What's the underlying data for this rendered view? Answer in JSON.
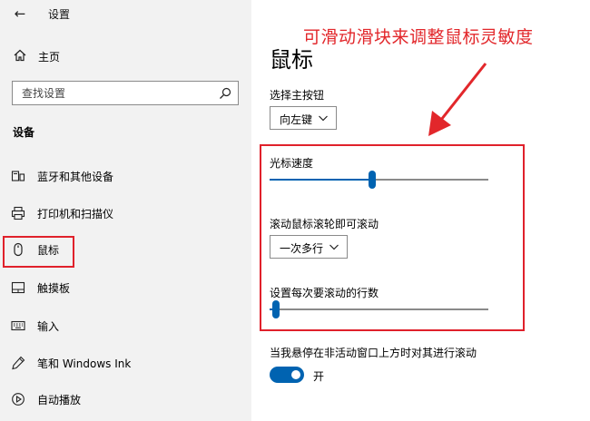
{
  "window": {
    "title": "设置",
    "back_glyph": "←"
  },
  "sidebar": {
    "home_label": "主页",
    "search_placeholder": "查找设置",
    "section_title": "设备",
    "items": [
      {
        "label": "蓝牙和其他设备",
        "icon": "bluetooth-icon"
      },
      {
        "label": "打印机和扫描仪",
        "icon": "printer-icon"
      },
      {
        "label": "鼠标",
        "icon": "mouse-icon",
        "selected": true
      },
      {
        "label": "触摸板",
        "icon": "touchpad-icon"
      },
      {
        "label": "输入",
        "icon": "keyboard-icon"
      },
      {
        "label": "笔和 Windows Ink",
        "icon": "pen-icon"
      },
      {
        "label": "自动播放",
        "icon": "autoplay-icon"
      }
    ]
  },
  "annotation": {
    "text": "可滑动滑块来调整鼠标灵敏度",
    "color": "#e2272b"
  },
  "main": {
    "title": "鼠标",
    "primary_button": {
      "label": "选择主按钮",
      "value": "向左键"
    },
    "cursor_speed": {
      "label": "光标速度",
      "value_fraction": 0.47
    },
    "scroll_setting": {
      "label": "滚动鼠标滚轮即可滚动",
      "value": "一次多行"
    },
    "lines_per_scroll": {
      "label": "设置每次要滚动的行数",
      "value_fraction": 0.03
    },
    "inactive_scroll": {
      "label": "当我悬停在非活动窗口上方时对其进行滚动",
      "state_label": "开",
      "on": true
    }
  },
  "colors": {
    "accent": "#0063b1",
    "highlight": "#e0212b",
    "sidebar_bg": "#f2f2f2"
  }
}
